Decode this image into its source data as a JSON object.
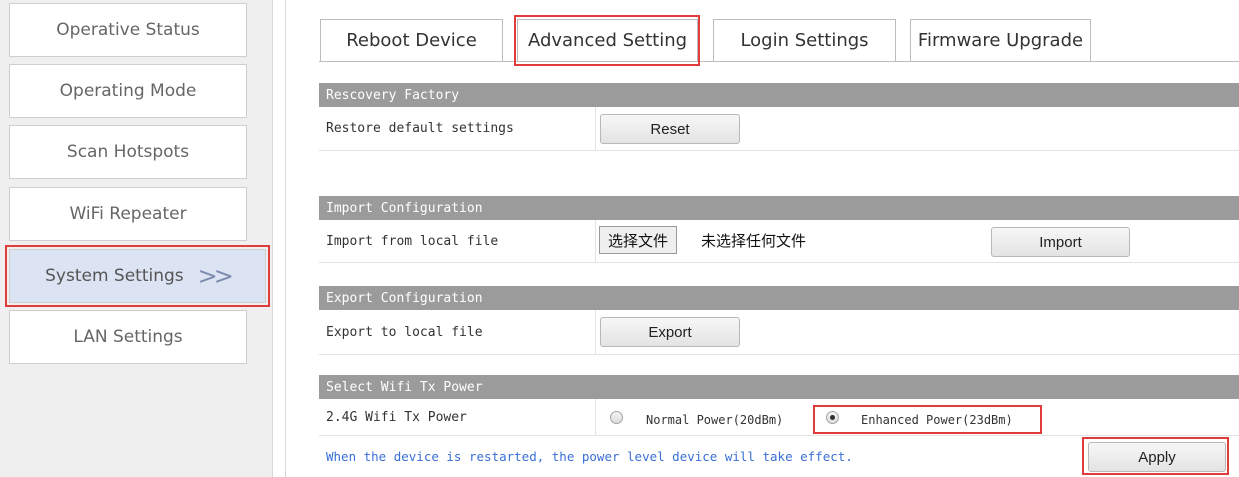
{
  "sidebar": {
    "items": [
      {
        "label": "Operative Status"
      },
      {
        "label": "Operating Mode"
      },
      {
        "label": "Scan Hotspots"
      },
      {
        "label": "WiFi Repeater"
      },
      {
        "label": "System Settings",
        "arrow": ">>"
      },
      {
        "label": "LAN Settings"
      }
    ],
    "active_index": 4
  },
  "tabs": [
    {
      "label": "Reboot Device"
    },
    {
      "label": "Advanced Setting"
    },
    {
      "label": "Login Settings"
    },
    {
      "label": "Firmware Upgrade"
    }
  ],
  "active_tab_index": 1,
  "recovery": {
    "header": "Rescovery Factory",
    "row_label": "Restore default settings",
    "button": "Reset"
  },
  "import": {
    "header": "Import Configuration",
    "row_label": "Import from local file",
    "file_button": "选择文件",
    "file_status": "未选择任何文件",
    "button": "Import"
  },
  "export": {
    "header": "Export Configuration",
    "row_label": "Export to local file",
    "button": "Export"
  },
  "tx_power": {
    "header": "Select Wifi Tx Power",
    "row_label": "2.4G Wifi Tx Power",
    "options": [
      {
        "label": "Normal Power(20dBm)",
        "checked": false
      },
      {
        "label": "Enhanced Power(23dBm)",
        "checked": true
      }
    ],
    "note": "When the device is restarted, the power level device will take effect.",
    "apply_button": "Apply"
  },
  "colors": {
    "highlight": "#e03c3c",
    "section_header_bg": "#9b9b9b",
    "active_nav_bg": "#dce3f3",
    "note_text": "#3a6fd8"
  }
}
